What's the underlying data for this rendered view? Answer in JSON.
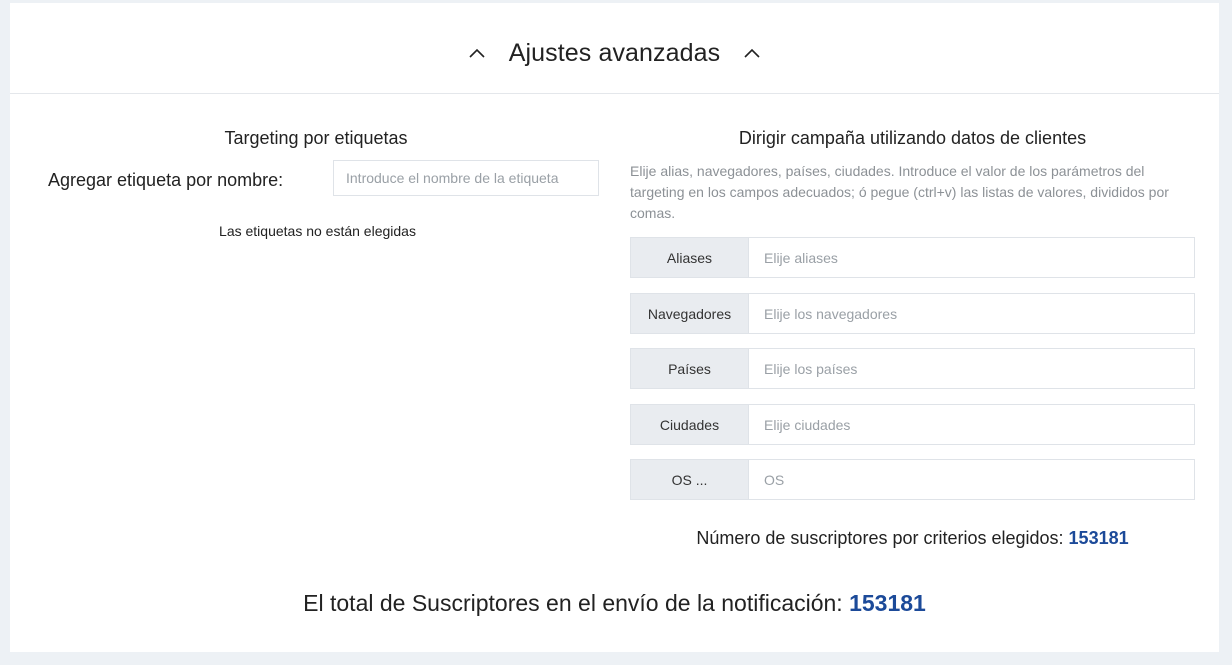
{
  "header": {
    "title": "Ajustes avanzadas"
  },
  "tag_targeting": {
    "title": "Targeting por etiquetas",
    "add_label": "Agregar etiqueta por nombre:",
    "input_placeholder": "Introduce el nombre de la etiqueta",
    "input_value": "",
    "empty_message": "Las etiquetas no están elegidas"
  },
  "customer_targeting": {
    "title": "Dirigir campaña utilizando datos de clientes",
    "description": "Elije alias, navegadores, países, ciudades. Introduce el valor de los parámetros del targeting en los campos adecuados; ó pegue (ctrl+v) las listas de valores, divididos por comas.",
    "fields": [
      {
        "label": "Aliases",
        "placeholder": "Elije aliases",
        "value": ""
      },
      {
        "label": "Navegadores",
        "placeholder": "Elije los navegadores",
        "value": ""
      },
      {
        "label": "Países",
        "placeholder": "Elije los países",
        "value": ""
      },
      {
        "label": "Ciudades",
        "placeholder": "Elije ciudades",
        "value": ""
      },
      {
        "label": "OS ...",
        "placeholder": "OS",
        "value": ""
      }
    ],
    "subscribers_label": "Número de suscriptores por criterios elegidos:",
    "subscribers_count": "153181"
  },
  "total": {
    "label": "El total de Suscriptores en el envío de la notificación:",
    "count": "153181"
  },
  "colors": {
    "accent": "#1c4a99",
    "background": "#edf1f5",
    "label_bg": "#e9ecf0",
    "border": "#dfe3e8"
  },
  "icons": {
    "collapse_left": "chevron-up-icon",
    "collapse_right": "chevron-up-icon"
  }
}
